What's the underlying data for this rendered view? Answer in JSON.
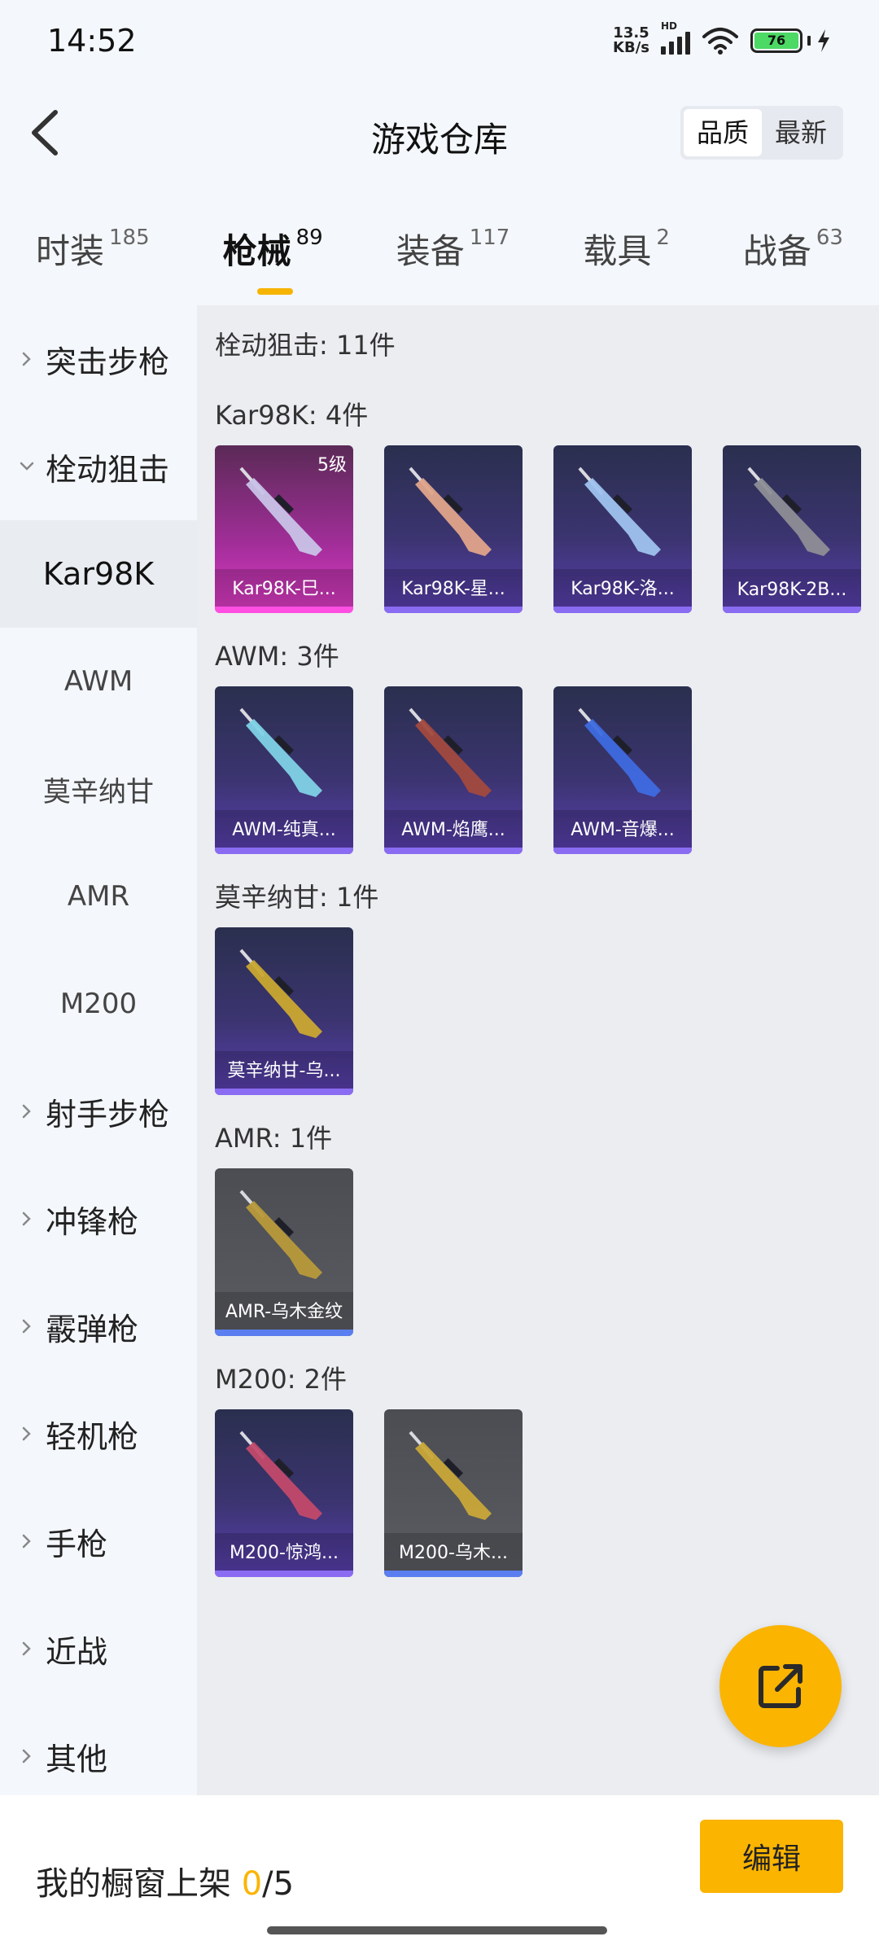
{
  "status": {
    "time": "14:52",
    "net_speed_value": "13.5",
    "net_speed_unit": "KB/s",
    "signal_label": "HD",
    "battery": "76"
  },
  "header": {
    "title": "游戏仓库",
    "sort_options": [
      "品质",
      "最新"
    ],
    "active_sort": "品质"
  },
  "tabs": [
    {
      "label": "时装",
      "count": "185"
    },
    {
      "label": "枪械",
      "count": "89",
      "active": true
    },
    {
      "label": "装备",
      "count": "117"
    },
    {
      "label": "载具",
      "count": "2"
    },
    {
      "label": "战备",
      "count": "63"
    }
  ],
  "sidebar": {
    "items": [
      {
        "label": "突击步枪",
        "type": "parent",
        "expanded": false
      },
      {
        "label": "栓动狙击",
        "type": "parent",
        "expanded": true
      },
      {
        "label": "Kar98K",
        "type": "sub",
        "selected": true
      },
      {
        "label": "AWM",
        "type": "sub"
      },
      {
        "label": "莫辛纳甘",
        "type": "sub"
      },
      {
        "label": "AMR",
        "type": "sub"
      },
      {
        "label": "M200",
        "type": "sub"
      },
      {
        "label": "射手步枪",
        "type": "parent",
        "expanded": false
      },
      {
        "label": "冲锋枪",
        "type": "parent",
        "expanded": false
      },
      {
        "label": "霰弹枪",
        "type": "parent",
        "expanded": false
      },
      {
        "label": "轻机枪",
        "type": "parent",
        "expanded": false
      },
      {
        "label": "手枪",
        "type": "parent",
        "expanded": false
      },
      {
        "label": "近战",
        "type": "parent",
        "expanded": false
      },
      {
        "label": "其他",
        "type": "parent",
        "expanded": false
      }
    ]
  },
  "content": {
    "category_summary": "栓动狙击: 11件",
    "groups": [
      {
        "title": "Kar98K: 4件",
        "items": [
          {
            "name": "Kar98K-巳...",
            "level": "5级",
            "quality": "pink",
            "gun_color": "#c9c3e8"
          },
          {
            "name": "Kar98K-星...",
            "quality": "purple",
            "gun_color": "#e0a48a"
          },
          {
            "name": "Kar98K-洛...",
            "quality": "purple",
            "gun_color": "#9fc3ee"
          },
          {
            "name": "Kar98K-2B...",
            "quality": "purple",
            "gun_color": "#8e8e96"
          }
        ]
      },
      {
        "title": "AWM: 3件",
        "items": [
          {
            "name": "AWM-纯真...",
            "quality": "purple",
            "gun_color": "#7fd2e6"
          },
          {
            "name": "AWM-焰鹰...",
            "quality": "purple",
            "gun_color": "#a24a3e"
          },
          {
            "name": "AWM-音爆...",
            "quality": "purple",
            "gun_color": "#3e6be0"
          }
        ]
      },
      {
        "title": "莫辛纳甘: 1件",
        "items": [
          {
            "name": "莫辛纳甘-乌...",
            "quality": "purple",
            "gun_color": "#caa830"
          }
        ]
      },
      {
        "title": "AMR: 1件",
        "items": [
          {
            "name": "AMR-乌木金纹",
            "quality": "gray",
            "gun_color": "#b89a3a"
          }
        ]
      },
      {
        "title": "M200: 2件",
        "items": [
          {
            "name": "M200-惊鸿...",
            "quality": "purple",
            "gun_color": "#c24a6a"
          },
          {
            "name": "M200-乌木...",
            "quality": "gray",
            "gun_color": "#c9a838"
          }
        ]
      }
    ]
  },
  "fab": {
    "icon": "share-external-icon"
  },
  "footer": {
    "showcase_label": "我的橱窗上架",
    "showcase_current": "0",
    "showcase_total": "/5",
    "edit_label": "编辑"
  },
  "colors": {
    "accent": "#fbb400",
    "epic_purple": "#8a6cf2",
    "legendary_pink": "#ff4fe2",
    "rare_blue": "#5a7ef0"
  }
}
